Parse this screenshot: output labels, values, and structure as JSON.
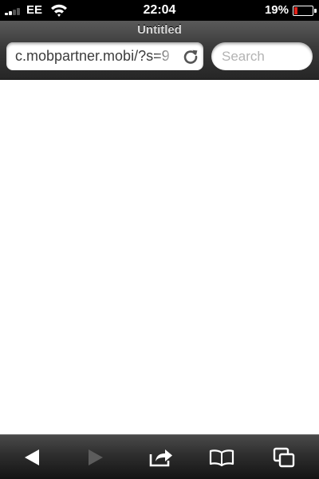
{
  "status_bar": {
    "carrier": "EE",
    "time": "22:04",
    "battery_percent": "19%",
    "battery_level": 0.19,
    "signal_bars": 2,
    "battery_color": "#e2231a"
  },
  "browser": {
    "page_title": "Untitled",
    "url": "c.mobpartner.mobi/?s=9",
    "search_placeholder": "Search",
    "reload_icon": "reload-icon"
  },
  "toolbar": {
    "items": [
      {
        "name": "back-button",
        "icon": "back-arrow-icon",
        "enabled": true
      },
      {
        "name": "forward-button",
        "icon": "forward-arrow-icon",
        "enabled": false
      },
      {
        "name": "share-button",
        "icon": "share-icon",
        "enabled": true
      },
      {
        "name": "bookmarks-button",
        "icon": "bookmarks-icon",
        "enabled": true
      },
      {
        "name": "tabs-button",
        "icon": "tabs-icon",
        "enabled": true
      }
    ]
  }
}
